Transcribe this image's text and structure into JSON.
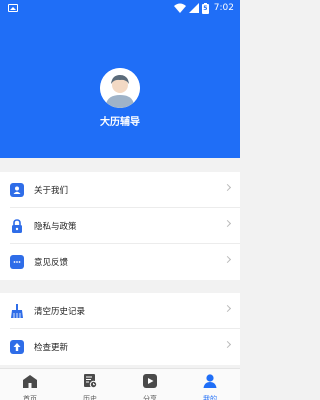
{
  "status_bar": {
    "time": "7:02",
    "battery_level": "5",
    "icons": [
      "image-icon",
      "wifi-icon",
      "signal-icon",
      "battery-icon"
    ]
  },
  "profile": {
    "name": "大历辅导",
    "avatar_icon": "default-avatar-icon"
  },
  "menu_groups": [
    {
      "items": [
        {
          "label": "关于我们",
          "icon": "about-icon"
        },
        {
          "label": "隐私与政策",
          "icon": "lock-icon"
        },
        {
          "label": "意见反馈",
          "icon": "feedback-icon"
        }
      ]
    },
    {
      "items": [
        {
          "label": "清空历史记录",
          "icon": "broom-icon"
        },
        {
          "label": "检查更新",
          "icon": "update-icon"
        }
      ]
    }
  ],
  "tabbar": {
    "tabs": [
      {
        "label": "首页",
        "icon": "home-icon",
        "active": false
      },
      {
        "label": "历史",
        "icon": "history-icon",
        "active": false
      },
      {
        "label": "分享",
        "icon": "share-icon",
        "active": false
      },
      {
        "label": "我的",
        "icon": "user-icon",
        "active": true
      }
    ]
  },
  "colors": {
    "accent": "#1f6ef7",
    "icon_blue": "#2f6de8",
    "background": "#f2f2f2",
    "tab_inactive": "#555555"
  }
}
